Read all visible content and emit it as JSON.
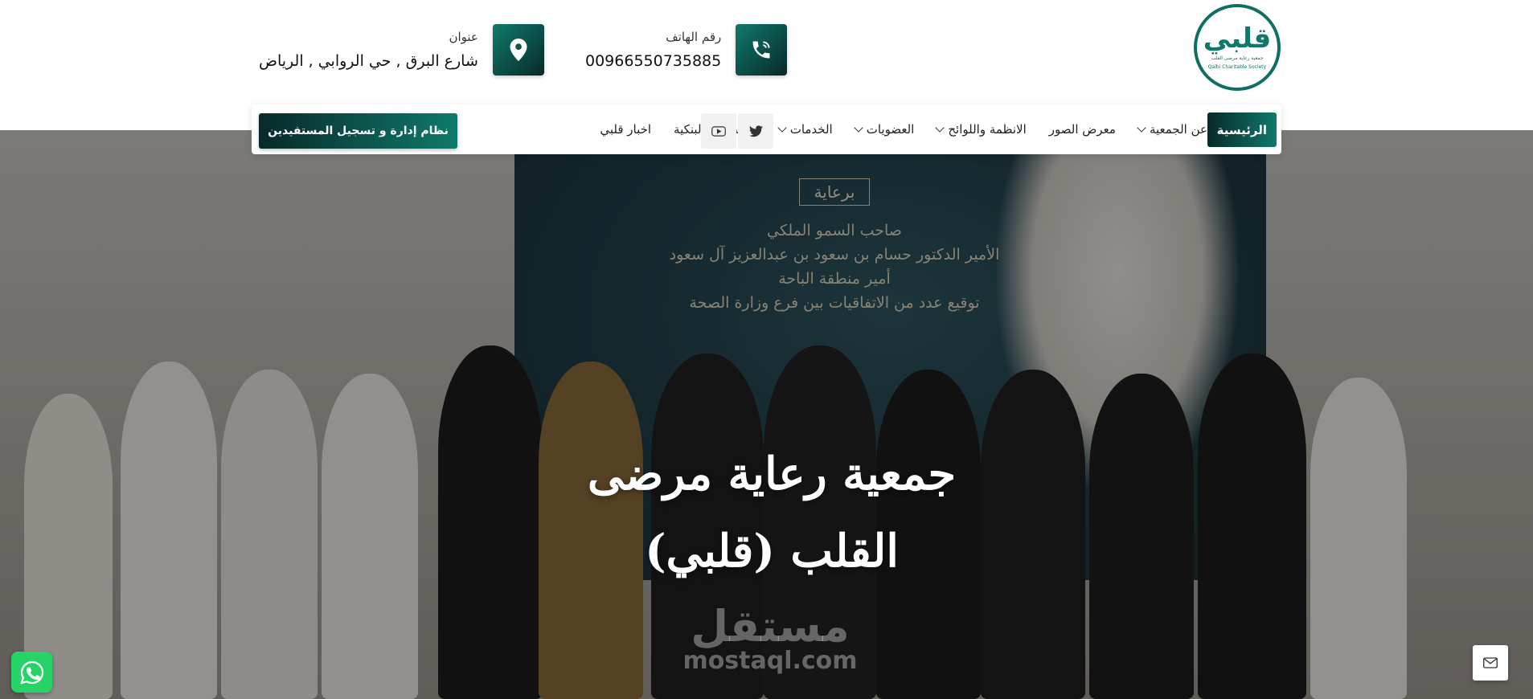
{
  "logo": {
    "mark": "قلبي",
    "subtitle_ar": "جمعية رعاية مرضى القلب",
    "subtitle_en": "Qalbi Charitable Society"
  },
  "header": {
    "phone": {
      "label": "رقم الهاتف",
      "value": "00966550735885",
      "icon": "phone-icon"
    },
    "address": {
      "label": "عنوان",
      "value": "شارع البرق , حي الروابي , الرياض",
      "icon": "map-pin-icon"
    }
  },
  "nav": {
    "home": "الرئيسية",
    "items": [
      {
        "label": "عن الجمعية",
        "has_dropdown": true
      },
      {
        "label": "معرض الصور",
        "has_dropdown": false
      },
      {
        "label": "الانظمة واللوائح",
        "has_dropdown": true
      },
      {
        "label": "العضويات",
        "has_dropdown": true
      },
      {
        "label": "الخدمات",
        "has_dropdown": true
      },
      {
        "label": "الحسابات البنكية",
        "has_dropdown": false
      },
      {
        "label": "اخبار قلبي",
        "has_dropdown": false
      }
    ],
    "social": [
      "twitter-icon",
      "youtube-icon"
    ],
    "cta": "نظام إدارة و تسجيل المستفيدين"
  },
  "hero": {
    "backdrop": {
      "sponsor": "برعاية",
      "line1": "صاحب السمو الملكي",
      "line2": "الأمير الدكتور حسام بن سعود بن عبدالعزيز آل سعود",
      "line3": "أمير منطقة الباحة",
      "line4": "توقيع عدد من الاتفاقيات بين فرع وزارة الصحة"
    },
    "title_line1": "جمعية رعاية مرضى",
    "title_line2": "القلب (قلبي)",
    "watermark_ar": "مستقل",
    "watermark_en": "mostaql.com"
  },
  "floating": {
    "whatsapp": "whatsapp-icon",
    "mail": "mail-icon"
  },
  "colors": {
    "primary": "#0f7a6b",
    "primary_dark": "#08292a",
    "whatsapp": "#25d366"
  }
}
